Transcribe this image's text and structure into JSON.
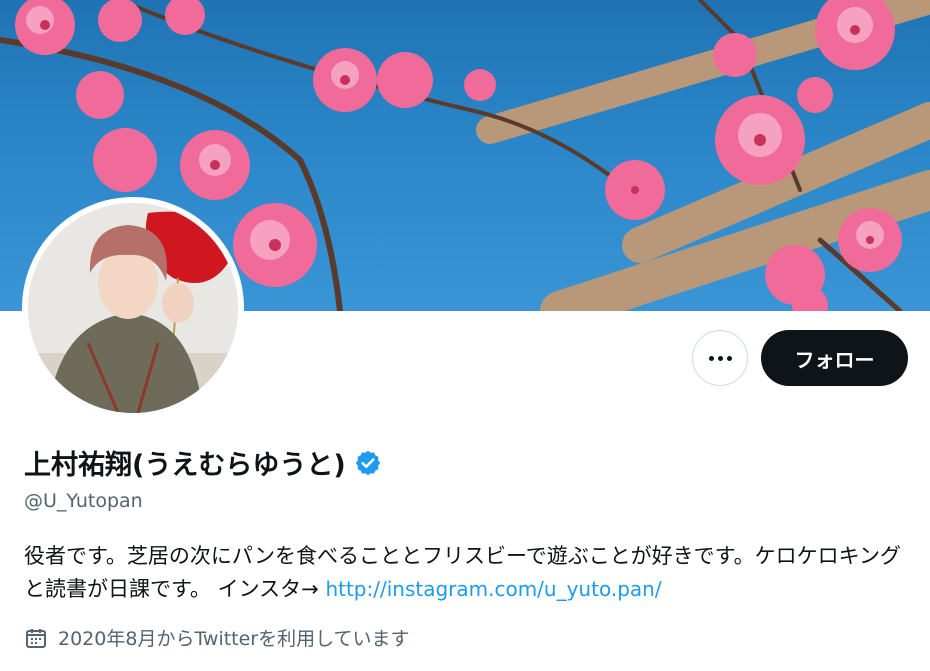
{
  "profile": {
    "display_name": "上村祐翔(うえむらゆうと)",
    "handle": "@U_Yutopan",
    "bio_text": "役者です。芝居の次にパンを食べることとフリスビーで遊ぶことが好きです。ケロケロキングと読書が日課です。 インスタ→ ",
    "bio_link": "http://instagram.com/u_yuto.pan/",
    "joined": "2020年8月からTwitterを利用しています",
    "verified": true
  },
  "actions": {
    "follow_label": "フォロー",
    "more_icon": "more-dots-icon"
  },
  "colors": {
    "accent": "#1d9bf0",
    "follow_bg": "#0f1419",
    "muted": "#536471",
    "banner_sky": "#2a86c8",
    "blossom": "#f06a9a"
  }
}
